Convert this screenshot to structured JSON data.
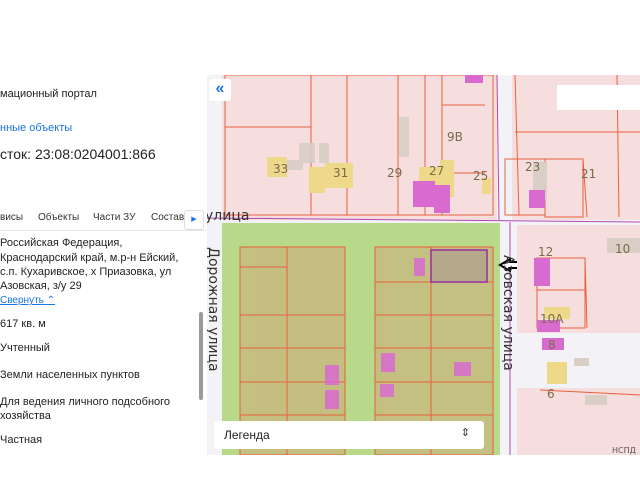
{
  "panel": {
    "portal_title": "мационный портал",
    "related_link": "нные объекты",
    "parcel_title": "сток: 23:08:0204001:866",
    "tabs": [
      "висы",
      "Объекты",
      "Части ЗУ",
      "Состав"
    ],
    "tabs_scroll_icon": "triangle-right-icon",
    "address": [
      "Российская Федерация,",
      "Краснодарский край, м.р-н Ейский,",
      "с.п. Кухаривское, х Приазовка, ул",
      "Азовская, з/у 29"
    ],
    "collapse_link": "Свернуть",
    "fields": {
      "area": "617 кв. м",
      "status": "Учтенный",
      "category": "Земли населенных пунктов",
      "use": [
        "Для ведения личного подсобного",
        "хозяйства"
      ],
      "ownership": "Частная"
    }
  },
  "map": {
    "collapse_button": "«",
    "house_numbers": [
      "33",
      "31",
      "29",
      "27",
      "9В",
      "25",
      "23",
      "21",
      "12",
      "10",
      "10А",
      "8",
      "6"
    ],
    "streets": {
      "top": "улица",
      "left": "Дорожная  улица",
      "right": "Азовская  улица"
    },
    "legend_label": "Легенда",
    "attribution": "НСПД",
    "colors": {
      "selected_parcel": "#b5a98a",
      "parcel_border": "#e8603c",
      "green_zone": "#b9d98a",
      "pink_zone": "#f6dede",
      "building": "#d96bd0",
      "accent": "#1a73e8"
    }
  }
}
